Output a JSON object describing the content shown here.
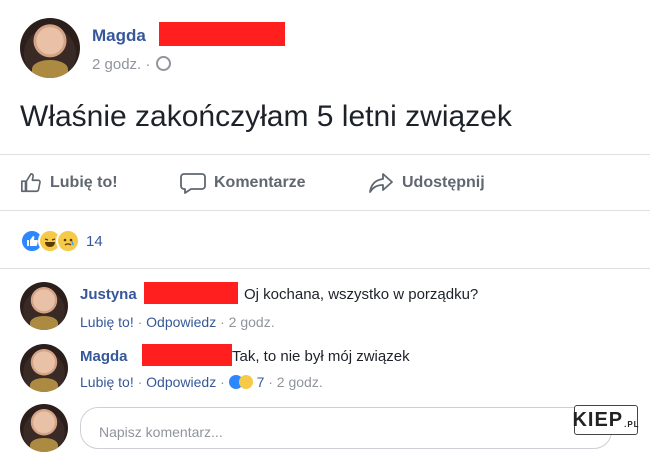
{
  "post": {
    "author": "Magda",
    "time": "2 godz. ·",
    "text": "Właśnie zakończyłam 5 letni związek"
  },
  "actions": {
    "like": "Lubię to!",
    "comment": "Komentarze",
    "share": "Udostępnij"
  },
  "reactions": {
    "count": "14",
    "icons": [
      "like-reaction",
      "haha-reaction",
      "sad-reaction"
    ]
  },
  "comments": [
    {
      "author": "Justyna",
      "text": "Oj kochana, wszystko w porządku?",
      "like": "Lubię to!",
      "sep1": " · ",
      "reply": "Odpowiedz",
      "time": " · 2 godz."
    },
    {
      "author": "Magda",
      "text": "Tak, to nie był mój związek",
      "like": "Lubię to!",
      "sep1": " · ",
      "reply": "Odpowiedz",
      "sep2": " · ",
      "reaction_count": "7",
      "time": " · 2 godz."
    }
  ],
  "composer": {
    "placeholder": "Napisz komentarz..."
  },
  "watermark": {
    "text": "KIEP",
    "suffix": ".PL"
  },
  "colors": {
    "link": "#365899",
    "muted": "#90949c",
    "redaction": "#ff1f1f"
  }
}
